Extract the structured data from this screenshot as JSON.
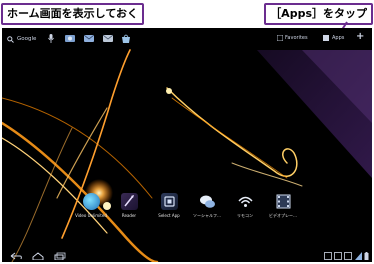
{
  "callouts": {
    "left": "ホーム画面を表示しておく",
    "right": "［Apps］をタップ"
  },
  "colors": {
    "callout_border": "#6b2d8f",
    "wallpaper": "#000000",
    "light_streak": "#ffb347"
  },
  "top_bar": {
    "search_label": "Google",
    "favorites_label": "Favorites",
    "apps_label": "Apps",
    "add_icon": "plus-icon",
    "shortcut_icons": [
      "mic-icon",
      "gallery-icon",
      "mail-icon",
      "email-icon",
      "market-icon"
    ]
  },
  "dock": {
    "apps": [
      {
        "label": "Video Unlimited",
        "icon": "video-unlimited-icon"
      },
      {
        "label": "Reader",
        "icon": "reader-icon"
      },
      {
        "label": "Select App",
        "icon": "select-app-icon"
      },
      {
        "label": "ソーシャルフ…",
        "icon": "social-feed-icon"
      },
      {
        "label": "リモコン",
        "icon": "remote-control-icon"
      },
      {
        "label": "ビデオプレー…",
        "icon": "video-player-icon"
      }
    ]
  },
  "nav_bar": {
    "icons": [
      "back-icon",
      "home-icon",
      "recent-apps-icon"
    ],
    "status_icons": [
      "notification-icon",
      "wifi-icon",
      "battery-icon"
    ]
  }
}
